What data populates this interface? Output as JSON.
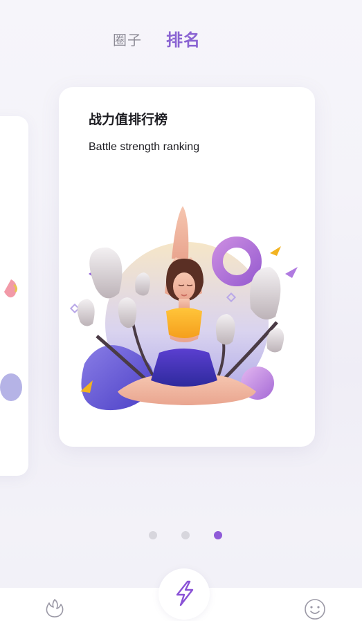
{
  "tabs": [
    {
      "label": "圈子",
      "active": false
    },
    {
      "label": "排名",
      "active": true
    }
  ],
  "card": {
    "title": "战力值排行榜",
    "subtitle": "Battle strength ranking",
    "illustration": "yoga-meditation-illustration"
  },
  "pagination": {
    "total": 3,
    "active_index": 2
  },
  "bottom_nav": {
    "left_icon": "fire-icon",
    "center_icon": "lightning-icon",
    "right_icon": "smile-icon"
  },
  "colors": {
    "accent": "#8a63d2",
    "inactive_tab": "#8c8a95",
    "dot_inactive": "#d7d6dd",
    "dot_active": "#8f5bd8"
  }
}
